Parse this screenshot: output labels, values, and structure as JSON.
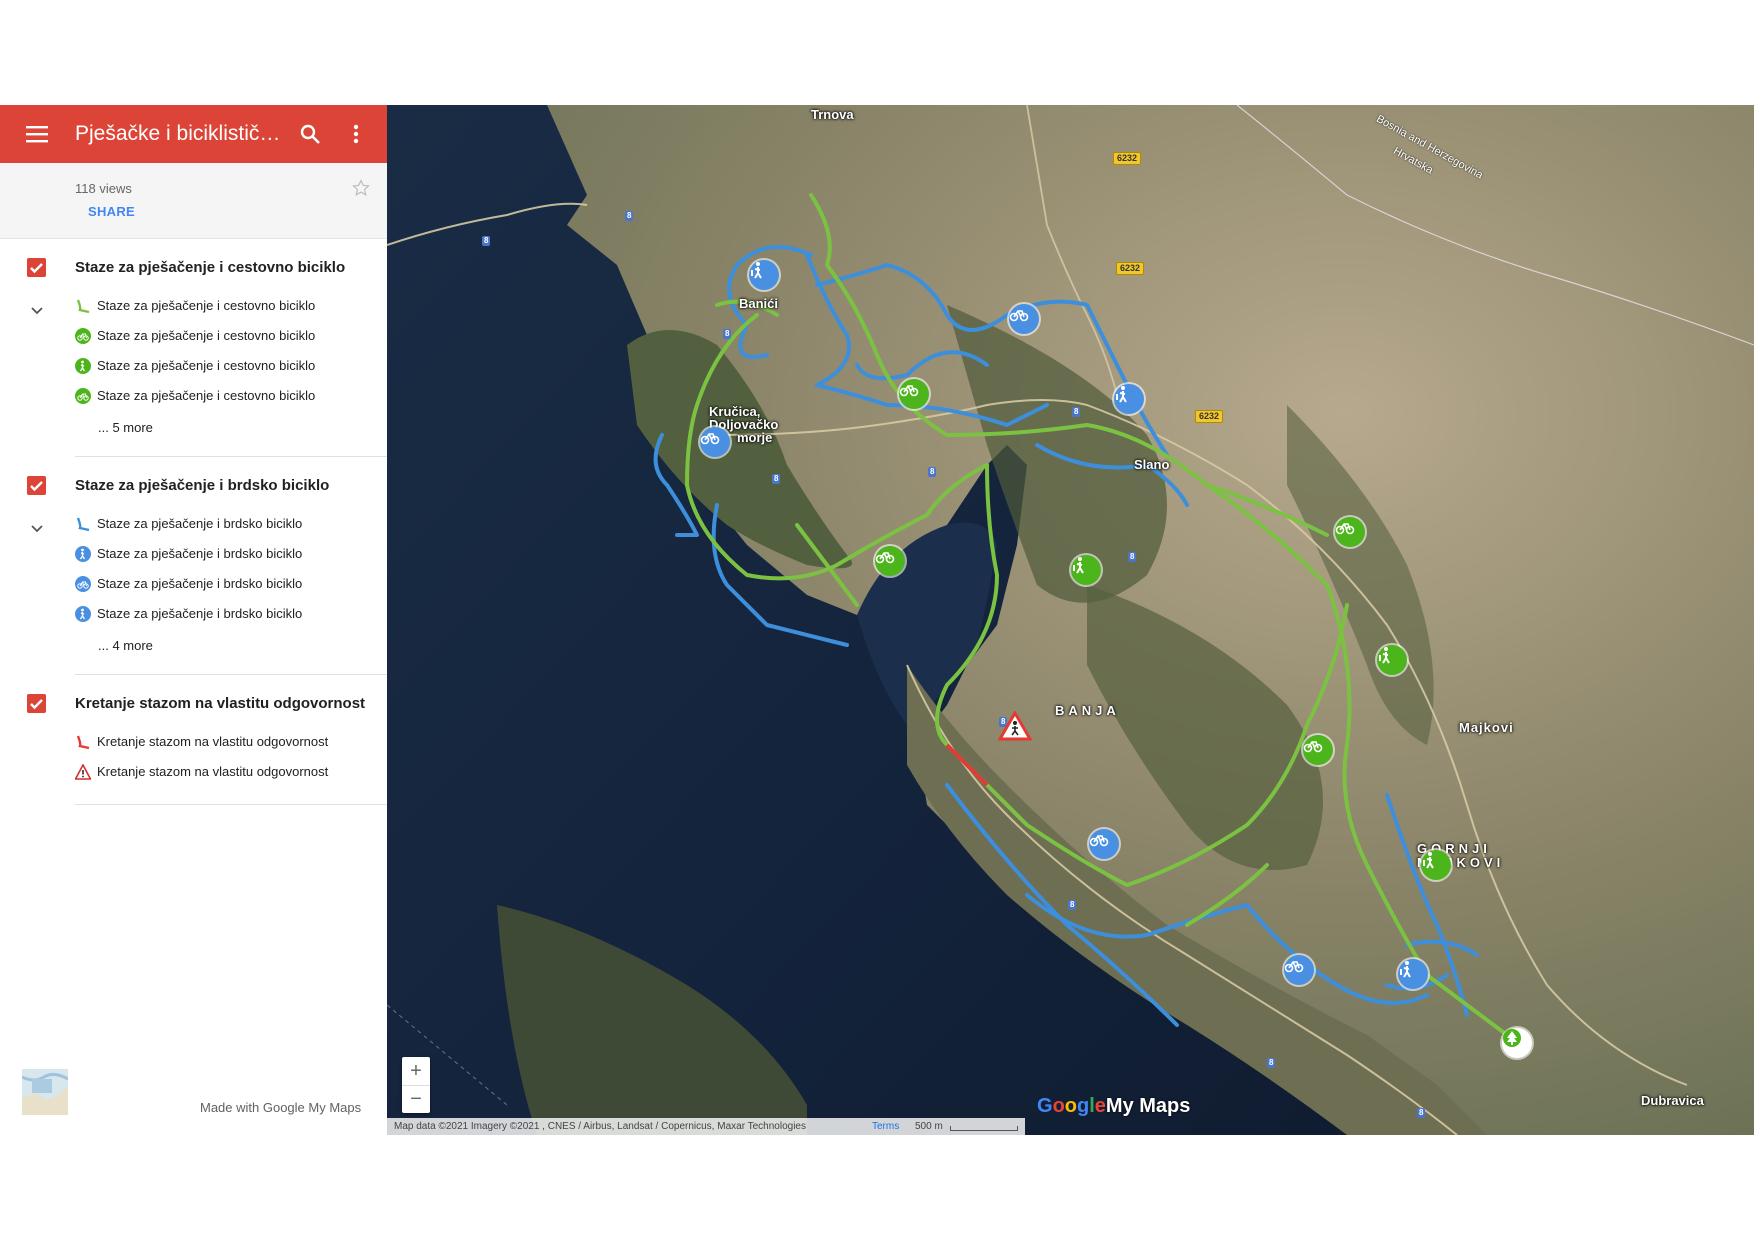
{
  "header": {
    "title": "Pješačke i biciklističke ...",
    "views": "118 views",
    "share_label": "SHARE"
  },
  "layers": [
    {
      "title": "Staze za pješačenje i cestovno biciklo",
      "items": [
        {
          "label": "Staze za pješačenje i cestovno biciklo",
          "icon": "green-line-icon"
        },
        {
          "label": "Staze za pješačenje i cestovno biciklo",
          "icon": "green-bike-icon"
        },
        {
          "label": "Staze za pješačenje i cestovno biciklo",
          "icon": "green-hiker-icon"
        },
        {
          "label": "Staze za pješačenje i cestovno biciklo",
          "icon": "green-bike-icon"
        }
      ],
      "more": "... 5 more"
    },
    {
      "title": "Staze za pješačenje i brdsko biciklo",
      "items": [
        {
          "label": "Staze za pješačenje i brdsko biciklo",
          "icon": "blue-line-icon"
        },
        {
          "label": "Staze za pješačenje i brdsko biciklo",
          "icon": "blue-hiker-icon"
        },
        {
          "label": "Staze za pješačenje i brdsko biciklo",
          "icon": "blue-bike-icon"
        },
        {
          "label": "Staze za pješačenje i brdsko biciklo",
          "icon": "blue-hiker-icon"
        }
      ],
      "more": "... 4 more"
    },
    {
      "title": "Kretanje stazom na vlastitu odgovornost",
      "items": [
        {
          "label": "Kretanje stazom na vlastitu odgovornost",
          "icon": "red-line-icon"
        },
        {
          "label": "Kretanje stazom na vlastitu odgovornost",
          "icon": "warning-triangle-icon"
        }
      ]
    }
  ],
  "footer": {
    "made_with": "Made with Google My Maps"
  },
  "map": {
    "places": {
      "trnova": "Trnova",
      "banici": "Banići",
      "krucica_1": "Kručica,",
      "krucica_2": "Doljovačko",
      "krucica_3": "morje",
      "slano": "Slano",
      "banja": "BANJA",
      "majkovi": "Majkovi",
      "gornji_1": "GORNJI",
      "gornji_2": "MAJKOVI",
      "dubravica": "Dubravica"
    },
    "border_labels": {
      "bih": "Bosnia and Herzegovina",
      "hr": "Hrvatska"
    },
    "road_shields": {
      "r6232": "6232",
      "r8": "8"
    },
    "zoom_in": "+",
    "zoom_out": "−",
    "brand": {
      "g1": "G",
      "g2": "o",
      "g3": "o",
      "g4": "g",
      "g5": "l",
      "g6": "e",
      "rest": "My Maps"
    },
    "attribution": "Map data ©2021 Imagery ©2021 , CNES / Airbus, Landsat / Copernicus, Maxar Technologies",
    "terms": "Terms",
    "scale": "500 m"
  },
  "colors": {
    "header_red": "#db4437",
    "green_route": "#7cc242",
    "blue_route": "#3d8fdc",
    "share_blue": "#4285f4"
  }
}
